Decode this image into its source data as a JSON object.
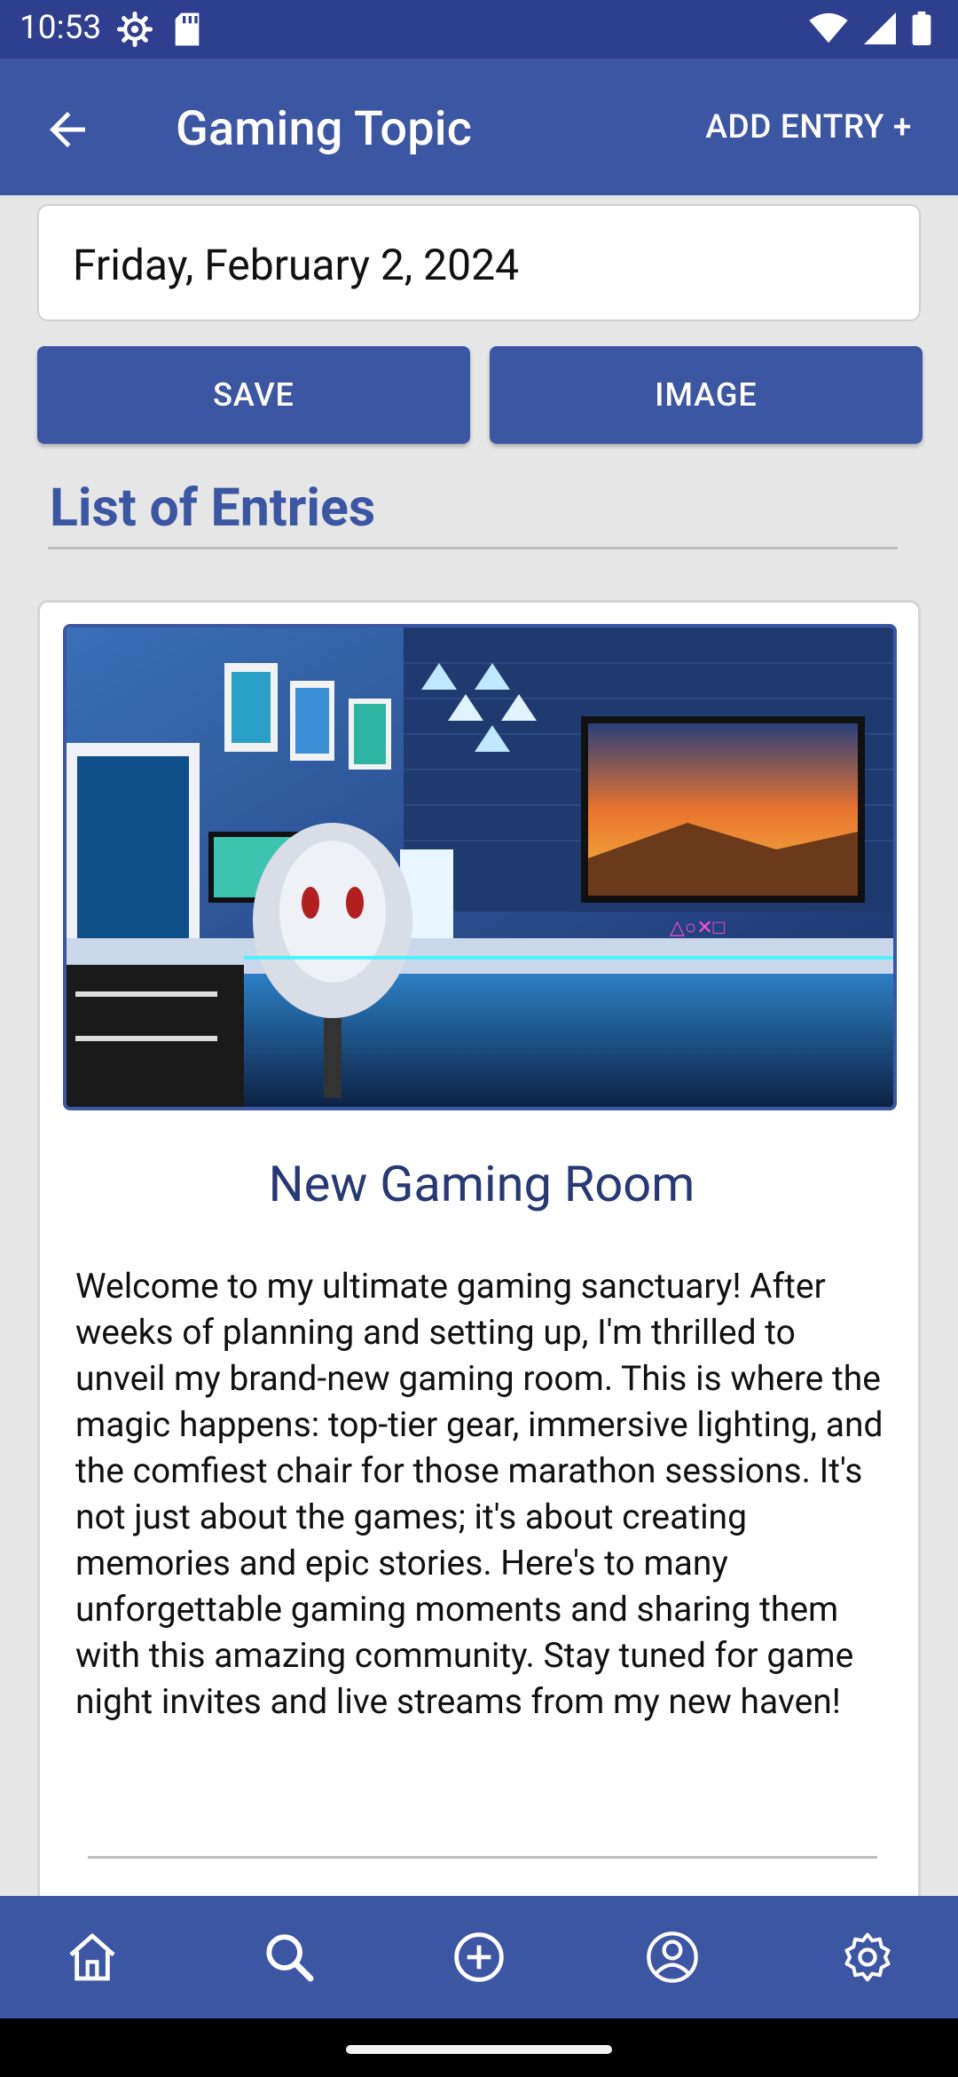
{
  "status_bar": {
    "time": "10:53",
    "icons_left": [
      "settings-gear-icon",
      "sd-card-icon"
    ],
    "icons_right": [
      "wifi-icon",
      "cell-signal-icon",
      "battery-icon"
    ]
  },
  "app_bar": {
    "title": "Gaming Topic",
    "action_label": "ADD ENTRY +",
    "back_icon": "arrow-back-icon"
  },
  "form": {
    "date_value": "Friday, February 2, 2024",
    "save_label": "SAVE",
    "image_label": "IMAGE"
  },
  "list": {
    "heading": "List of Entries",
    "entries": [
      {
        "title": "New Gaming Room",
        "body": "Welcome to my ultimate gaming sanctuary! After weeks of planning and setting up, I'm thrilled to unveil my brand-new gaming room. This is where the magic happens: top-tier gear, immersive lighting, and the comfiest chair for those marathon sessions. It's not just about the games; it's about creating memories and epic stories. Here's to many unforgettable gaming moments and sharing them with this amazing community. Stay tuned for game night invites and live streams from my new haven!"
      }
    ]
  },
  "bottom_nav": {
    "items": [
      "home-icon",
      "search-icon",
      "add-circle-icon",
      "profile-icon",
      "settings-icon"
    ]
  },
  "colors": {
    "primary": "#3b56a3",
    "status_bar": "#2f3f8f",
    "title_text": "#283876",
    "background": "#e6e6e6"
  }
}
